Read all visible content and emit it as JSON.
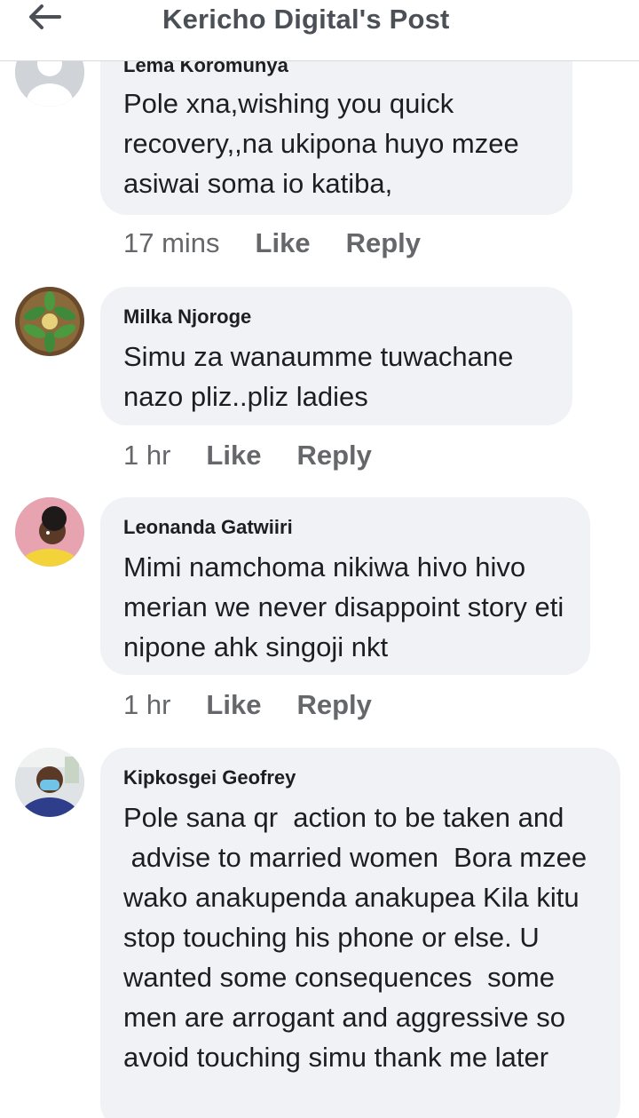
{
  "header": {
    "title": "Kericho Digital's Post",
    "back_icon": "arrow-left-icon"
  },
  "comments": [
    {
      "author": "Lema Koromunya",
      "text": "Pole xna,wishing you quick recovery,,na ukipona huyo mzee asiwai soma io katiba,",
      "time": "17 mins",
      "like": "Like",
      "reply": "Reply"
    },
    {
      "author": "Milka Njoroge",
      "text": "Simu za wanaumme tuwachane nazo pliz..pliz ladies",
      "time": "1 hr",
      "like": "Like",
      "reply": "Reply"
    },
    {
      "author": "Leonanda Gatwiiri",
      "text": "Mimi namchoma nikiwa hivo hivo merian we never disappoint story eti nipone ahk singoji nkt",
      "time": "1 hr",
      "like": "Like",
      "reply": "Reply"
    },
    {
      "author": "Kipkosgei Geofrey",
      "text": "Pole sana qr  action to be taken and\n advise to married women  Bora mzee wako anakupenda anakupea Kila kitu stop touching his phone or else. U  wanted some consequences  some men are arrogant and aggressive so avoid touching simu thank me later",
      "time": "",
      "like": "",
      "reply": ""
    }
  ]
}
